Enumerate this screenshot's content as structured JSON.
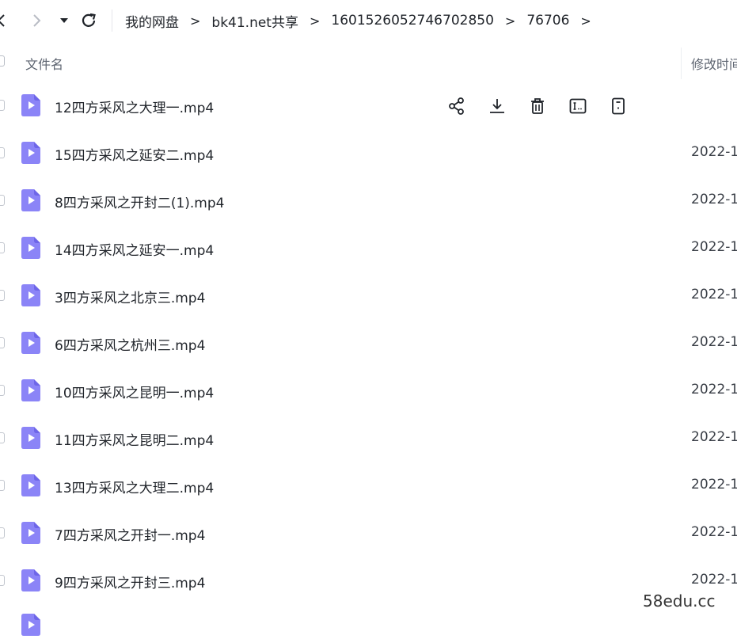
{
  "breadcrumb": [
    "我的网盘",
    "bk41.net共享",
    "1601526052746702850",
    "76706"
  ],
  "breadcrumb_separator": ">",
  "columns": {
    "name": "文件名",
    "modified": "修改时间"
  },
  "rows": [
    {
      "name": "12四方采风之大理一.mp4",
      "date": ""
    },
    {
      "name": "15四方采风之延安二.mp4",
      "date": "2022-1"
    },
    {
      "name": "8四方采风之开封二(1).mp4",
      "date": "2022-1"
    },
    {
      "name": "14四方采风之延安一.mp4",
      "date": "2022-1"
    },
    {
      "name": "3四方采风之北京三.mp4",
      "date": "2022-1"
    },
    {
      "name": "6四方采风之杭州三.mp4",
      "date": "2022-1"
    },
    {
      "name": "10四方采风之昆明一.mp4",
      "date": "2022-1"
    },
    {
      "name": "11四方采风之昆明二.mp4",
      "date": "2022-1"
    },
    {
      "name": "13四方采风之大理二.mp4",
      "date": "2022-1"
    },
    {
      "name": "7四方采风之开封一.mp4",
      "date": "2022-1"
    },
    {
      "name": "9四方采风之开封三.mp4",
      "date": "2022-1"
    }
  ],
  "row_actions": [
    "share-icon",
    "download-icon",
    "delete-icon",
    "rename-icon",
    "more-icon"
  ],
  "watermark": "58edu.cc",
  "colors": {
    "video_icon": "#8b84f7",
    "video_icon_dark": "#6e66e8",
    "text": "#1f2329",
    "muted": "#5d6470"
  }
}
